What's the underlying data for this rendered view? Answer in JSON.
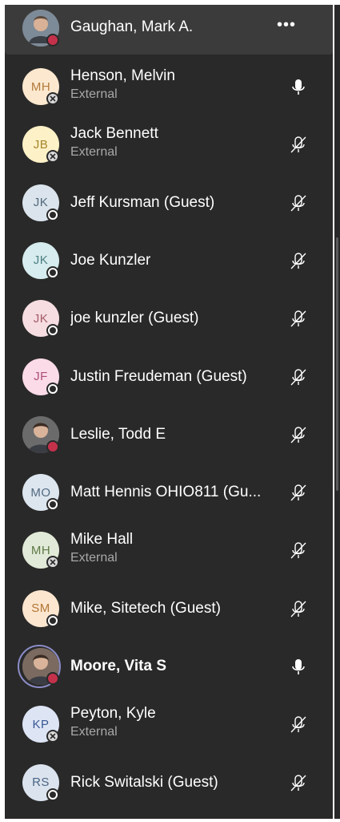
{
  "header_item": {
    "name": "Gaughan, Mark A.",
    "more_label": "•••"
  },
  "participants": [
    {
      "initials": "MH",
      "name": "Henson, Melvin",
      "sub": "External",
      "mic": "on",
      "avatar_bg": "#fce8cf",
      "avatar_fg": "#b37a3b"
    },
    {
      "initials": "JB",
      "name": "Jack Bennett",
      "sub": "External",
      "mic": "muted",
      "avatar_bg": "#fdf1c7",
      "avatar_fg": "#a6862a"
    },
    {
      "initials": "JK",
      "name": "Jeff Kursman (Guest)",
      "sub": "",
      "mic": "muted",
      "avatar_bg": "#dbe4ec",
      "avatar_fg": "#52697c"
    },
    {
      "initials": "JK",
      "name": "Joe Kunzler",
      "sub": "",
      "mic": "muted",
      "avatar_bg": "#d6ecee",
      "avatar_fg": "#4e7e83"
    },
    {
      "initials": "JK",
      "name": "joe kunzler (Guest)",
      "sub": "",
      "mic": "muted",
      "avatar_bg": "#f6dde1",
      "avatar_fg": "#a45b67"
    },
    {
      "initials": "JF",
      "name": "Justin Freudeman (Guest)",
      "sub": "",
      "mic": "muted",
      "avatar_bg": "#fbdbe8",
      "avatar_fg": "#ab4f78"
    },
    {
      "initials": "",
      "name": "Leslie, Todd E",
      "sub": "",
      "mic": "muted",
      "avatar_bg": "#6b6b6b",
      "avatar_fg": "#ffffff"
    },
    {
      "initials": "MO",
      "name": "Matt Hennis OHIO811 (Gu...",
      "sub": "",
      "mic": "muted",
      "avatar_bg": "#dde6ef",
      "avatar_fg": "#526a80"
    },
    {
      "initials": "MH",
      "name": "Mike Hall",
      "sub": "External",
      "mic": "muted",
      "avatar_bg": "#e1ead8",
      "avatar_fg": "#5f7a47"
    },
    {
      "initials": "SM",
      "name": "Mike, Sitetech (Guest)",
      "sub": "",
      "mic": "muted",
      "avatar_bg": "#fce6cf",
      "avatar_fg": "#b27534"
    },
    {
      "initials": "",
      "name": "Moore, Vita S",
      "sub": "",
      "mic": "on",
      "avatar_bg": "#7a6a60",
      "avatar_fg": "#ffffff"
    },
    {
      "initials": "KP",
      "name": "Peyton, Kyle",
      "sub": "External",
      "mic": "muted",
      "avatar_bg": "#dde5f5",
      "avatar_fg": "#3a5894"
    },
    {
      "initials": "RS",
      "name": "Rick Switalski (Guest)",
      "sub": "",
      "mic": "muted",
      "avatar_bg": "#dbe3ee",
      "avatar_fg": "#4b6584"
    }
  ],
  "colors": {
    "panel_bg": "#292929",
    "highlight_bg": "#3b3b3b",
    "busy": "#c4314b",
    "text": "#ffffff",
    "subtext": "#a8a8a8"
  }
}
